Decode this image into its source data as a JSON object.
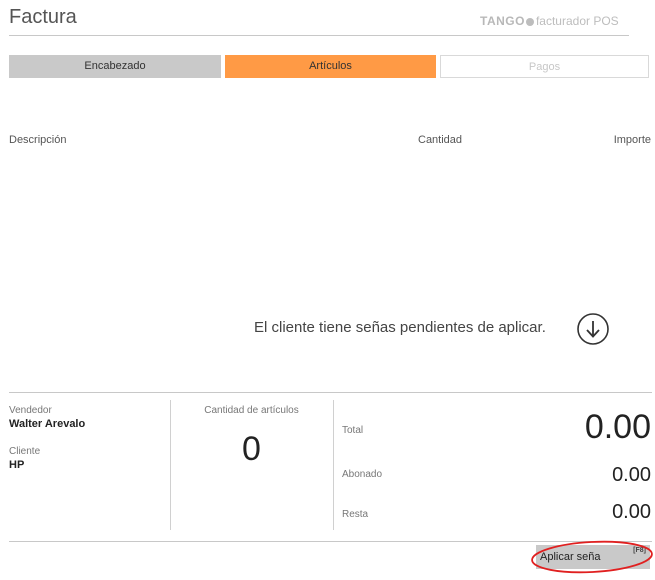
{
  "header": {
    "title": "Factura",
    "brand_logo": "TANGO",
    "brand_product": "facturador POS"
  },
  "tabs": [
    {
      "label": "Encabezado",
      "state": "inactive"
    },
    {
      "label": "Artículos",
      "state": "active"
    },
    {
      "label": "Pagos",
      "state": "disabled"
    }
  ],
  "columns": {
    "description": "Descripción",
    "quantity": "Cantidad",
    "amount": "Importe"
  },
  "notice": {
    "text": "El cliente tiene señas pendientes de aplicar.",
    "icon": "arrow-down-circle-icon"
  },
  "summary": {
    "seller_label": "Vendedor",
    "seller_value": "Walter Arevalo",
    "client_label": "Cliente",
    "client_value": "HP",
    "item_count_label": "Cantidad de artículos",
    "item_count_value": "0",
    "total_label": "Total",
    "total_value": "0.00",
    "paid_label": "Abonado",
    "paid_value": "0.00",
    "remaining_label": "Resta",
    "remaining_value": "0.00"
  },
  "footer": {
    "apply_button_label": "Aplicar seña",
    "apply_button_shortcut": "[F8]",
    "highlight_color": "#e02020"
  },
  "colors": {
    "active_tab": "#ff9a45",
    "inactive_tab": "#c9c9c9",
    "button_bg": "#c9c9c9"
  }
}
